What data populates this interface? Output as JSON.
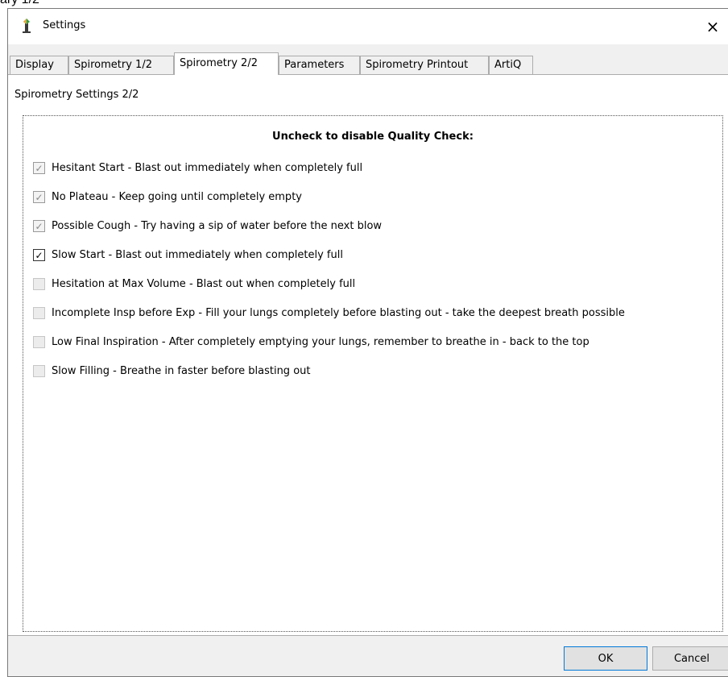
{
  "background_caption": "ary 1/2",
  "window": {
    "title": "Settings",
    "close_symbol": "×"
  },
  "tabs": [
    {
      "label": "Display",
      "active": false
    },
    {
      "label": "Spirometry 1/2",
      "active": false
    },
    {
      "label": "Spirometry 2/2",
      "active": true
    },
    {
      "label": "Parameters",
      "active": false
    },
    {
      "label": "Spirometry Printout",
      "active": false
    },
    {
      "label": "ArtiQ",
      "active": false
    }
  ],
  "panel": {
    "caption": "Spirometry Settings 2/2",
    "group_heading": "Uncheck to disable Quality Check:",
    "checks": [
      {
        "label": "Hesitant Start - Blast out immediately when completely full",
        "checked": true,
        "enabled": false
      },
      {
        "label": "No Plateau - Keep going until completely empty",
        "checked": true,
        "enabled": false
      },
      {
        "label": "Possible Cough - Try having a sip of water before the next blow",
        "checked": true,
        "enabled": false
      },
      {
        "label": "Slow Start  - Blast out immediately when completely full",
        "checked": true,
        "enabled": true
      },
      {
        "label": "Hesitation at Max Volume - Blast out when completely full",
        "checked": false,
        "enabled": false
      },
      {
        "label": "Incomplete Insp before Exp - Fill your lungs completely before blasting out - take the deepest breath possible",
        "checked": false,
        "enabled": false
      },
      {
        "label": "Low Final Inspiration - After completely emptying your lungs, remember to breathe in - back to the top",
        "checked": false,
        "enabled": false
      },
      {
        "label": "Slow Filling - Breathe in faster before blasting out",
        "checked": false,
        "enabled": false
      }
    ]
  },
  "buttons": {
    "ok_label": "OK",
    "cancel_label": "Cancel"
  },
  "icons": {
    "window_icon": "spirometer-app-icon",
    "check_mark": "✓"
  }
}
